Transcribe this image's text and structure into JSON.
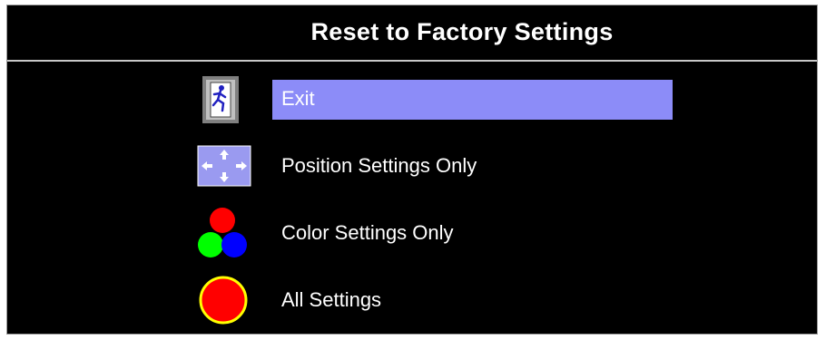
{
  "window": {
    "title": "Reset to Factory Settings"
  },
  "menu": {
    "selected_index": 0,
    "highlight_color": "#8c8cf8",
    "items": [
      {
        "label": "Exit",
        "icon": "exit-door-icon"
      },
      {
        "label": "Position Settings Only",
        "icon": "move-arrows-icon"
      },
      {
        "label": "Color Settings Only",
        "icon": "rgb-circles-icon"
      },
      {
        "label": "All Settings",
        "icon": "red-circle-icon"
      }
    ]
  }
}
